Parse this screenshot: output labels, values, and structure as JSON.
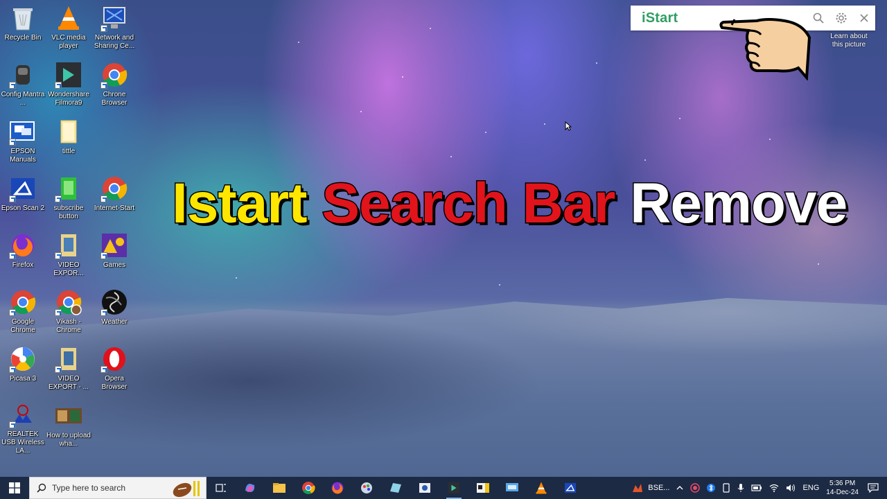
{
  "desktop": {
    "icons": [
      {
        "label": "Recycle Bin",
        "icon": "recycle-bin-icon"
      },
      {
        "label": "VLC media player",
        "icon": "vlc-icon"
      },
      {
        "label": "Network and Sharing Ce...",
        "icon": "network-icon"
      },
      {
        "label": "Config Mantra ...",
        "icon": "config-mantra-icon"
      },
      {
        "label": "Wondershare Filmora9",
        "icon": "filmora-icon"
      },
      {
        "label": "Chrone Browser",
        "icon": "chrome-icon"
      },
      {
        "label": "EPSON Manuals",
        "icon": "epson-manuals-icon"
      },
      {
        "label": "tittle",
        "icon": "folder-icon"
      },
      {
        "label": "Epson Scan 2",
        "icon": "epson-scan-icon"
      },
      {
        "label": "subscribe button",
        "icon": "subscribe-icon"
      },
      {
        "label": "Internet-Start",
        "icon": "chrome-icon"
      },
      {
        "label": "Firefox",
        "icon": "firefox-icon"
      },
      {
        "label": "VIDEO EXPOR...",
        "icon": "video-folder-icon"
      },
      {
        "label": "Games",
        "icon": "games-icon"
      },
      {
        "label": "Google Chrome",
        "icon": "chrome-icon"
      },
      {
        "label": "Vikash - Chrome",
        "icon": "chrome-user-icon"
      },
      {
        "label": "Weather",
        "icon": "weather-icon"
      },
      {
        "label": "Picasa 3",
        "icon": "picasa-icon"
      },
      {
        "label": "VIDEO EXPORT - ...",
        "icon": "video-folder-icon"
      },
      {
        "label": "Opera Browser",
        "icon": "opera-icon"
      },
      {
        "label": "REALTEK USB Wireless LA...",
        "icon": "realtek-icon"
      },
      {
        "label": "How to upload wha...",
        "icon": "video-thumb-icon"
      }
    ]
  },
  "istart": {
    "logo": "iStart",
    "search_placeholder": "",
    "learn_about": "Learn about this picture"
  },
  "headline": {
    "word1": "Istart",
    "word2": "Search",
    "word3": "Bar",
    "word4": "Remove"
  },
  "taskbar": {
    "search_placeholder": "Type here to search",
    "tray_app_label": "BSE...",
    "language": "ENG",
    "time": "5:36 PM",
    "date": "14-Dec-24"
  },
  "colors": {
    "istart_green": "#2f9e63",
    "headline_yellow": "#ffe600",
    "headline_red": "#e1141b",
    "taskbar_bg": "#1c2a44"
  }
}
